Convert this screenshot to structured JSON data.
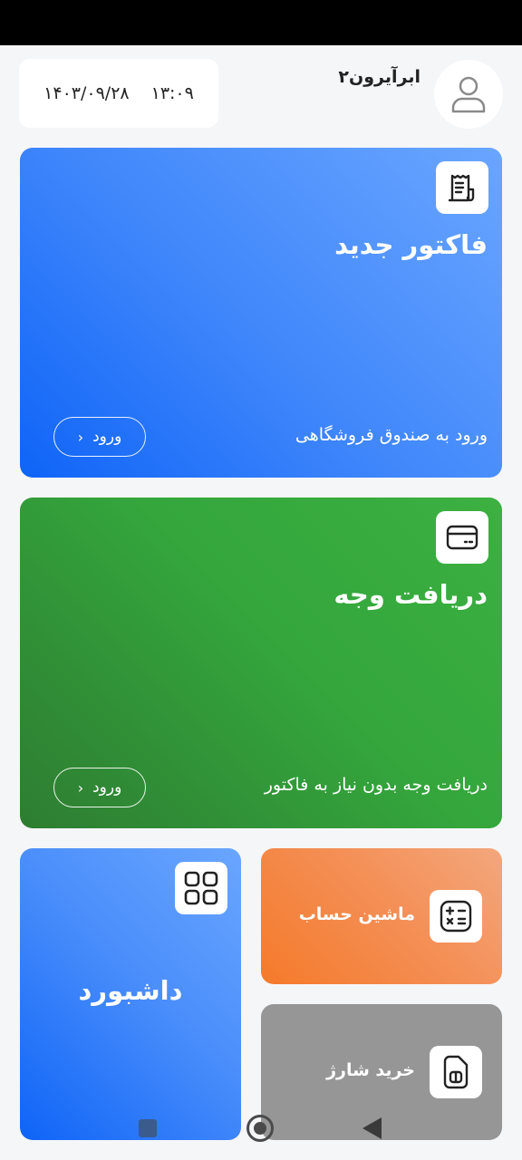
{
  "header": {
    "username": "ابرآیرون۲",
    "time": "۱۳:۰۹",
    "date": "۱۴۰۳/۰۹/۲۸"
  },
  "cards": {
    "invoice": {
      "title": "فاکتور جدید",
      "subtitle": "ورود به صندوق فروشگاهی",
      "button_label": "ورود",
      "icon": "receipt-icon"
    },
    "payment": {
      "title": "دریافت وجه",
      "subtitle": "دریافت وجه بدون نیاز به فاکتور",
      "button_label": "ورود",
      "icon": "card-icon"
    },
    "dashboard": {
      "title": "داشبورد",
      "icon": "grid-icon"
    },
    "calculator": {
      "title": "ماشین حساب",
      "icon": "calculator-icon"
    },
    "charge": {
      "title": "خرید شارژ",
      "icon": "sim-card-icon"
    }
  },
  "colors": {
    "blue": "#0f64f7",
    "green": "#34a63c",
    "orange": "#f57a2a",
    "gray": "#969696"
  }
}
